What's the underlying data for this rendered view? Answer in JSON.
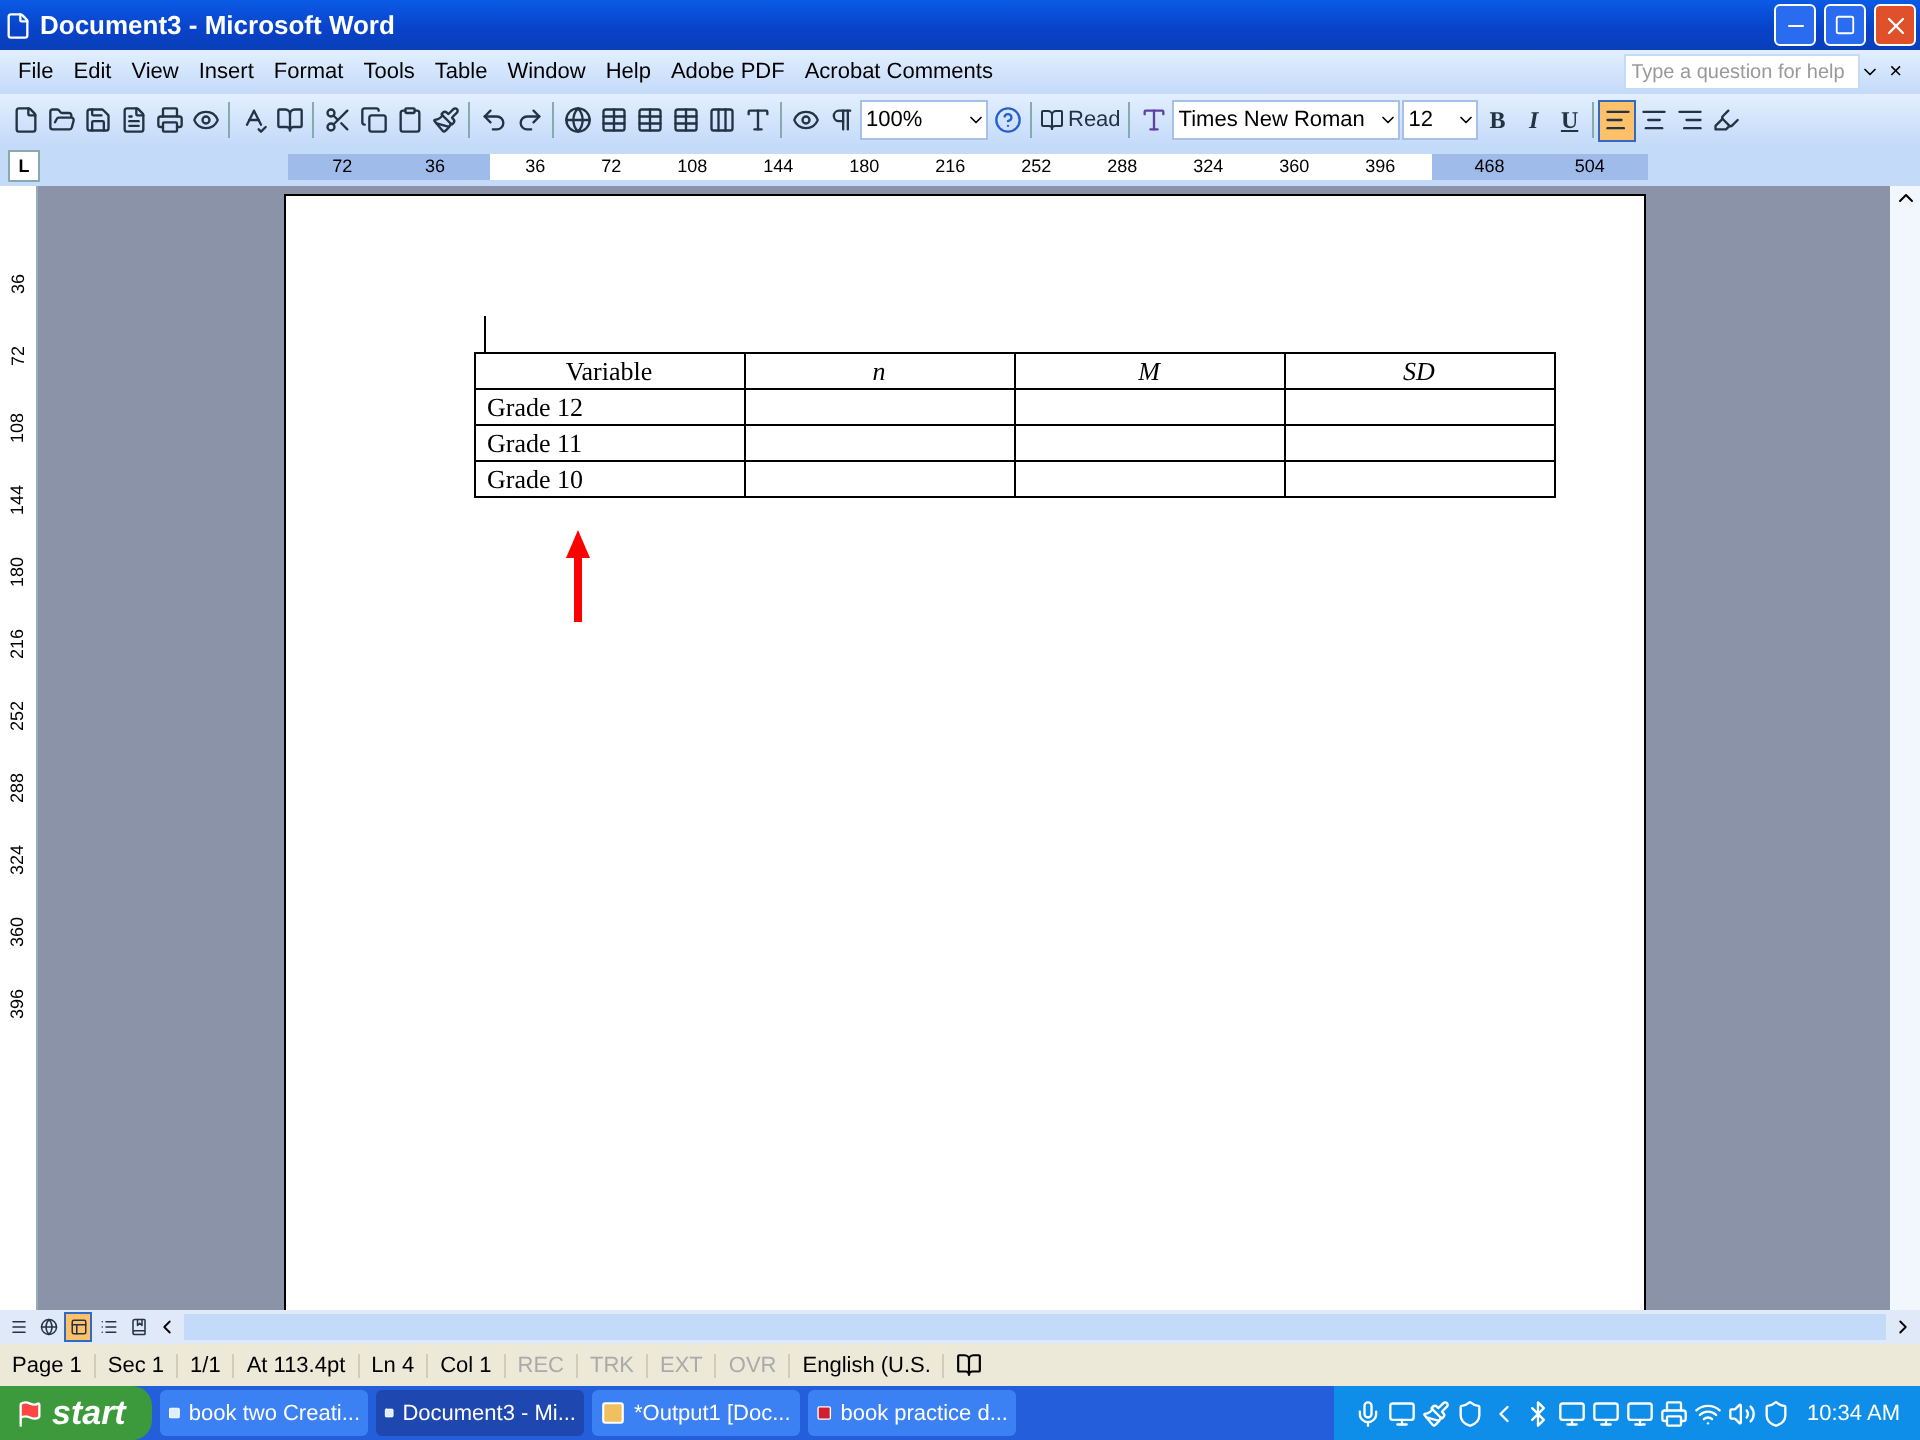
{
  "window": {
    "title": "Document3 - Microsoft Word"
  },
  "menu": {
    "items": [
      "File",
      "Edit",
      "View",
      "Insert",
      "Format",
      "Tools",
      "Table",
      "Window",
      "Help",
      "Adobe PDF",
      "Acrobat Comments"
    ],
    "help_box": {
      "placeholder": "Type a question for help"
    },
    "close": "×"
  },
  "toolbar": {
    "zoom": "100%",
    "read": "Read",
    "font": "Times New Roman",
    "size": "12",
    "format_buttons": [
      {
        "label": "B",
        "kind": "bold"
      },
      {
        "label": "I",
        "kind": "italic"
      },
      {
        "label": "U",
        "kind": "underline"
      }
    ],
    "alignment": [
      {
        "kind": "left",
        "selected": true
      },
      {
        "kind": "center",
        "selected": false
      },
      {
        "kind": "right",
        "selected": false
      }
    ]
  },
  "ruler": {
    "corner": "L",
    "left_labels": [
      "72",
      "36"
    ],
    "labels": [
      "36",
      "72",
      "108",
      "144",
      "180",
      "216",
      "252",
      "288",
      "324",
      "360",
      "396"
    ],
    "right_labels": [
      "468",
      "504"
    ],
    "vertical_labels": [
      "36",
      "72",
      "108",
      "144",
      "180",
      "216",
      "252",
      "288",
      "324",
      "360",
      "396"
    ]
  },
  "table": {
    "columns": [
      {
        "label": "Variable",
        "italic": false
      },
      {
        "label": "n",
        "italic": true
      },
      {
        "label": "M",
        "italic": true
      },
      {
        "label": "SD",
        "italic": true
      }
    ],
    "rows": [
      [
        "Grade 12"
      ],
      [
        "Grade 11"
      ],
      [
        "Grade 10"
      ]
    ]
  },
  "view_buttons": [
    {
      "kind": "normal",
      "selected": false
    },
    {
      "kind": "web",
      "selected": false
    },
    {
      "kind": "print",
      "selected": true
    },
    {
      "kind": "outline",
      "selected": false
    },
    {
      "kind": "reading",
      "selected": false
    }
  ],
  "status_bar": {
    "fields": [
      "Page 1",
      "Sec 1",
      "1/1",
      "At 113.4pt",
      "Ln 4",
      "Col 1"
    ],
    "indicators": [
      {
        "label": "REC",
        "disabled": true
      },
      {
        "label": "TRK",
        "disabled": true
      },
      {
        "label": "EXT",
        "disabled": true
      },
      {
        "label": "OVR",
        "disabled": true
      }
    ],
    "language": "English (U.S."
  },
  "taskbar": {
    "start": "start",
    "tasks": [
      {
        "label": "book two Creati...",
        "kind": "word",
        "selected": false
      },
      {
        "label": "Document3 - Mi...",
        "kind": "word",
        "selected": true
      },
      {
        "label": "*Output1 [Doc...",
        "kind": "spss",
        "selected": false
      },
      {
        "label": "book practice d...",
        "kind": "spss-red",
        "selected": false
      }
    ],
    "clock": "10:34 AM"
  }
}
